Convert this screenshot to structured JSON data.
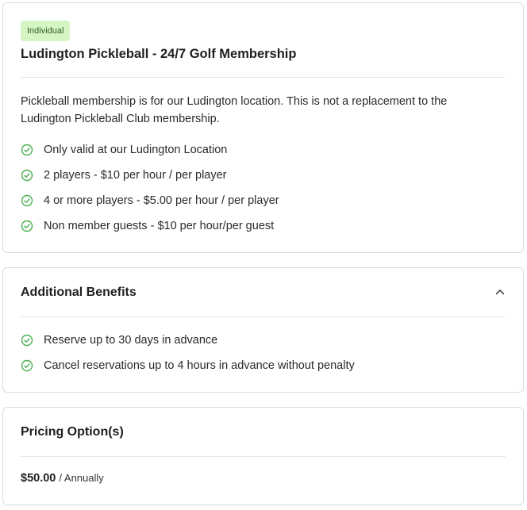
{
  "membership": {
    "badge": "Individual",
    "title": "Ludington Pickleball - 24/7 Golf Membership",
    "description": "Pickleball membership is for our Ludington location. This is not a replacement to the Ludington Pickleball Club membership.",
    "features": [
      "Only valid at our Ludington Location",
      "2 players - $10 per hour / per player",
      "4 or more players - $5.00 per hour / per player",
      "Non member guests - $10 per hour/per guest"
    ]
  },
  "benefits": {
    "title": "Additional Benefits",
    "items": [
      "Reserve up to 30 days in advance",
      "Cancel reservations up to 4 hours in advance without penalty"
    ]
  },
  "pricing": {
    "title": "Pricing Option(s)",
    "amount": "$50.00",
    "period": "/ Annually"
  },
  "colors": {
    "accent_green": "#4caf50",
    "badge_bg": "#d6f5c4",
    "border": "#dcdcdc"
  },
  "icons": {
    "feature": "check-circle-icon",
    "collapse": "chevron-up-icon"
  }
}
